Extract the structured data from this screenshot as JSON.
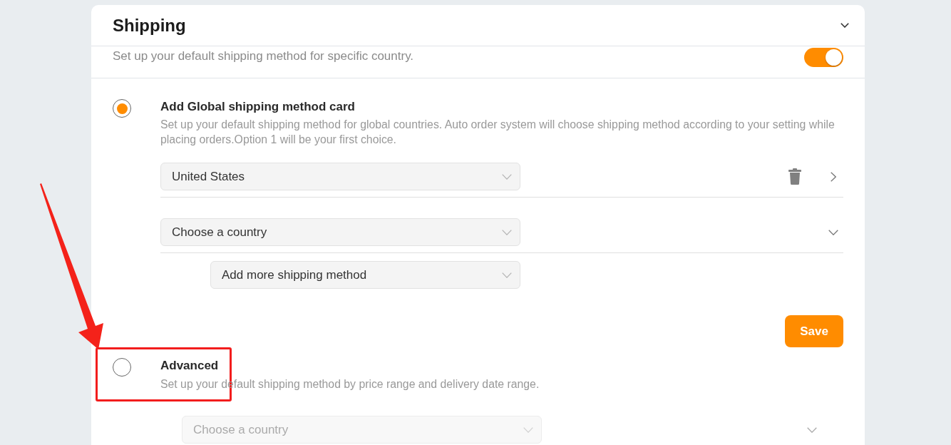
{
  "section": {
    "title": "Shipping",
    "expanded": true
  },
  "country_default": {
    "text": "Set up your default shipping method for specific country.",
    "on": true
  },
  "options": [
    {
      "kind": "basic",
      "title": "Add Global shipping method card",
      "description": "Set up your default shipping method for global countries. Auto order system will choose shipping method according to your setting while placing orders.Option 1 will be your first choice.",
      "selected": true,
      "rows": [
        {
          "dropdown": {
            "value": "United States",
            "disabled": false
          },
          "removable": true,
          "expanded": false
        },
        {
          "dropdown": {
            "placeholder": "Choose a country",
            "disabled": false
          },
          "removable": false,
          "expanded": true,
          "children": [
            {
              "placeholder": "Add more shipping method",
              "disabled": false
            }
          ]
        }
      ],
      "button": "Save"
    },
    {
      "kind": "advanced",
      "title": "Advanced",
      "description": "Set up your default shipping method by price range and delivery date range.",
      "selected": false,
      "rows": [
        {
          "dropdown": {
            "placeholder": "Choose a country",
            "disabled": true
          },
          "removable": false,
          "expanded": true
        }
      ]
    }
  ]
}
